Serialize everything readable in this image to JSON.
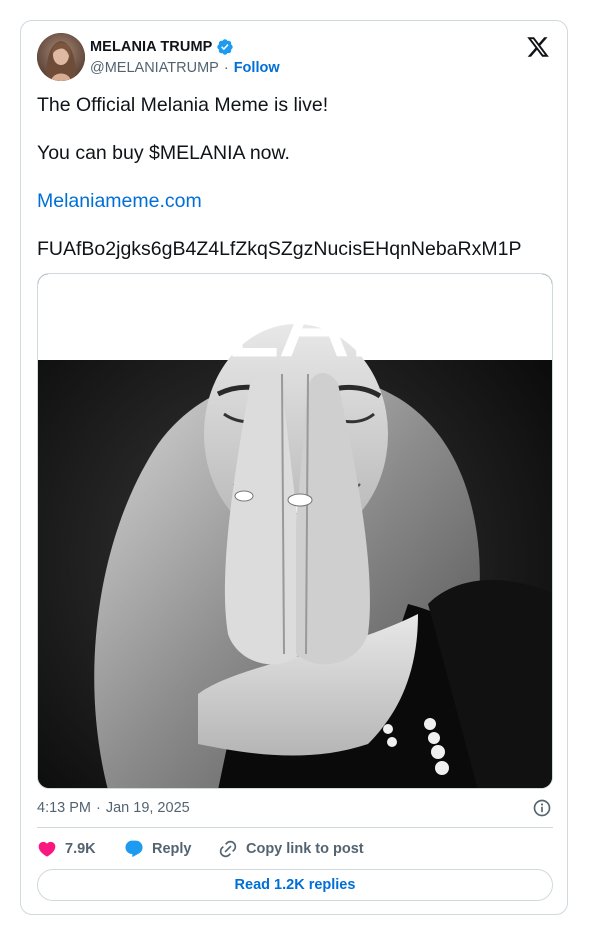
{
  "author": {
    "display_name": "MELANIA TRUMP",
    "handle": "@MELANIATRUMP",
    "separator": "·",
    "follow_label": "Follow",
    "verified": true,
    "avatar": "profile-photo"
  },
  "platform_icon": "x-logo-icon",
  "tweet": {
    "line1": "The Official Melania Meme is live!",
    "line2": "You can buy $MELANIA now.",
    "link": "Melaniameme.com",
    "address": "FUAfBo2jgks6gB4Z4LfZkqSZgzNucisEHqnNebaRxM1P"
  },
  "media": {
    "overlay_text": "MELANIA",
    "description_icon": "photo"
  },
  "meta": {
    "time": "4:13 PM",
    "separator": "·",
    "date": "Jan 19, 2025",
    "info_icon": "info-icon"
  },
  "actions": {
    "like_count": "7.9K",
    "reply_label": "Reply",
    "copy_label": "Copy link to post"
  },
  "read_replies_label": "Read 1.2K replies",
  "colors": {
    "link": "#006fd6",
    "like": "#f91880",
    "reply": "#1d9bf0",
    "verified": "#1d9bf0",
    "border": "#cfd9de",
    "muted": "#536471"
  }
}
